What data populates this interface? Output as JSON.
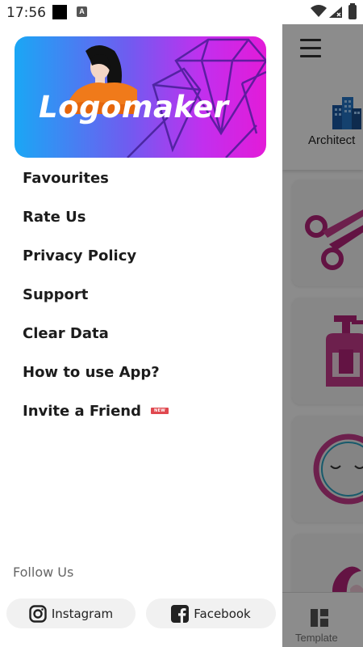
{
  "status_bar": {
    "time": "17:56",
    "icons": [
      "notification-square-icon",
      "a-icon",
      "wifi-icon",
      "signal-icon",
      "battery-icon"
    ]
  },
  "drawer": {
    "banner": {
      "title": "Logomaker",
      "colors": [
        "#1aa7f5",
        "#6f5cf0",
        "#c22fee",
        "#e31bd8"
      ]
    },
    "menu_items": [
      {
        "label": "Favourites"
      },
      {
        "label": "Rate Us"
      },
      {
        "label": "Privacy Policy"
      },
      {
        "label": "Support"
      },
      {
        "label": "Clear Data"
      },
      {
        "label": "How to use App?"
      },
      {
        "label": "Invite a Friend",
        "badge": "NEW"
      }
    ],
    "follow": {
      "label": "Follow Us",
      "instagram": "Instagram",
      "facebook": "Facebook"
    }
  },
  "background_app": {
    "category_label": "Architect",
    "bottom_nav_label": "Template",
    "card_icons": [
      "scissors-icon",
      "bottle-icon",
      "face-icon",
      "woman-hair-icon"
    ]
  }
}
